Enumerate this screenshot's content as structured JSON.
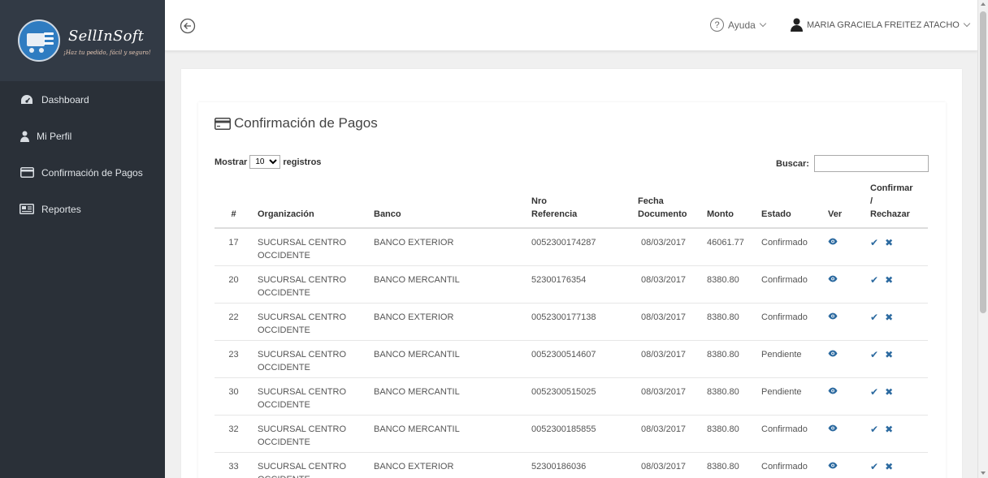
{
  "brand": {
    "name": "SellInSoft",
    "tagline": "¡Haz tu pedido, fácil y seguro!"
  },
  "sidebar": {
    "items": [
      {
        "label": "Dashboard",
        "icon": "dashboard-icon"
      },
      {
        "label": "Mi Perfil",
        "icon": "user-icon"
      },
      {
        "label": "Confirmación de Pagos",
        "icon": "credit-card-icon"
      },
      {
        "label": "Reportes",
        "icon": "report-icon"
      }
    ]
  },
  "topbar": {
    "help_label": "Ayuda",
    "user_name": "MARIA GRACIELA FREITEZ ATACHO"
  },
  "page": {
    "title": "Confirmación de Pagos",
    "length_prefix": "Mostrar",
    "length_value": "10",
    "length_suffix": "registros",
    "search_label": "Buscar:",
    "search_value": ""
  },
  "table": {
    "headers": {
      "num": "#",
      "org": "Organización",
      "bank": "Banco",
      "ref_1": "Nro",
      "ref_2": "Referencia",
      "date_1": "Fecha",
      "date_2": "Documento",
      "amount": "Monto",
      "status": "Estado",
      "view": "Ver",
      "action_1": "Confirmar",
      "action_2": "/",
      "action_3": "Rechazar"
    },
    "rows": [
      {
        "num": "17",
        "org": "SUCURSAL CENTRO OCCIDENTE",
        "bank": "BANCO EXTERIOR",
        "ref": "0052300174287",
        "date": "08/03/2017",
        "amount": "46061.77",
        "status": "Confirmado"
      },
      {
        "num": "20",
        "org": "SUCURSAL CENTRO OCCIDENTE",
        "bank": "BANCO MERCANTIL",
        "ref": "52300176354",
        "date": "08/03/2017",
        "amount": "8380.80",
        "status": "Confirmado"
      },
      {
        "num": "22",
        "org": "SUCURSAL CENTRO OCCIDENTE",
        "bank": "BANCO EXTERIOR",
        "ref": "0052300177138",
        "date": "08/03/2017",
        "amount": "8380.80",
        "status": "Confirmado"
      },
      {
        "num": "23",
        "org": "SUCURSAL CENTRO OCCIDENTE",
        "bank": "BANCO MERCANTIL",
        "ref": "0052300514607",
        "date": "08/03/2017",
        "amount": "8380.80",
        "status": "Pendiente"
      },
      {
        "num": "30",
        "org": "SUCURSAL CENTRO OCCIDENTE",
        "bank": "BANCO MERCANTIL",
        "ref": "0052300515025",
        "date": "08/03/2017",
        "amount": "8380.80",
        "status": "Pendiente"
      },
      {
        "num": "32",
        "org": "SUCURSAL CENTRO OCCIDENTE",
        "bank": "BANCO MERCANTIL",
        "ref": "0052300185855",
        "date": "08/03/2017",
        "amount": "8380.80",
        "status": "Confirmado"
      },
      {
        "num": "33",
        "org": "SUCURSAL CENTRO OCCIDENTE",
        "bank": "BANCO EXTERIOR",
        "ref": "52300186036",
        "date": "08/03/2017",
        "amount": "8380.80",
        "status": "Confirmado"
      }
    ]
  },
  "colors": {
    "sidebar_bg": "#2a3038",
    "brand_bg": "#323a45",
    "accent": "#2c6aa0"
  }
}
